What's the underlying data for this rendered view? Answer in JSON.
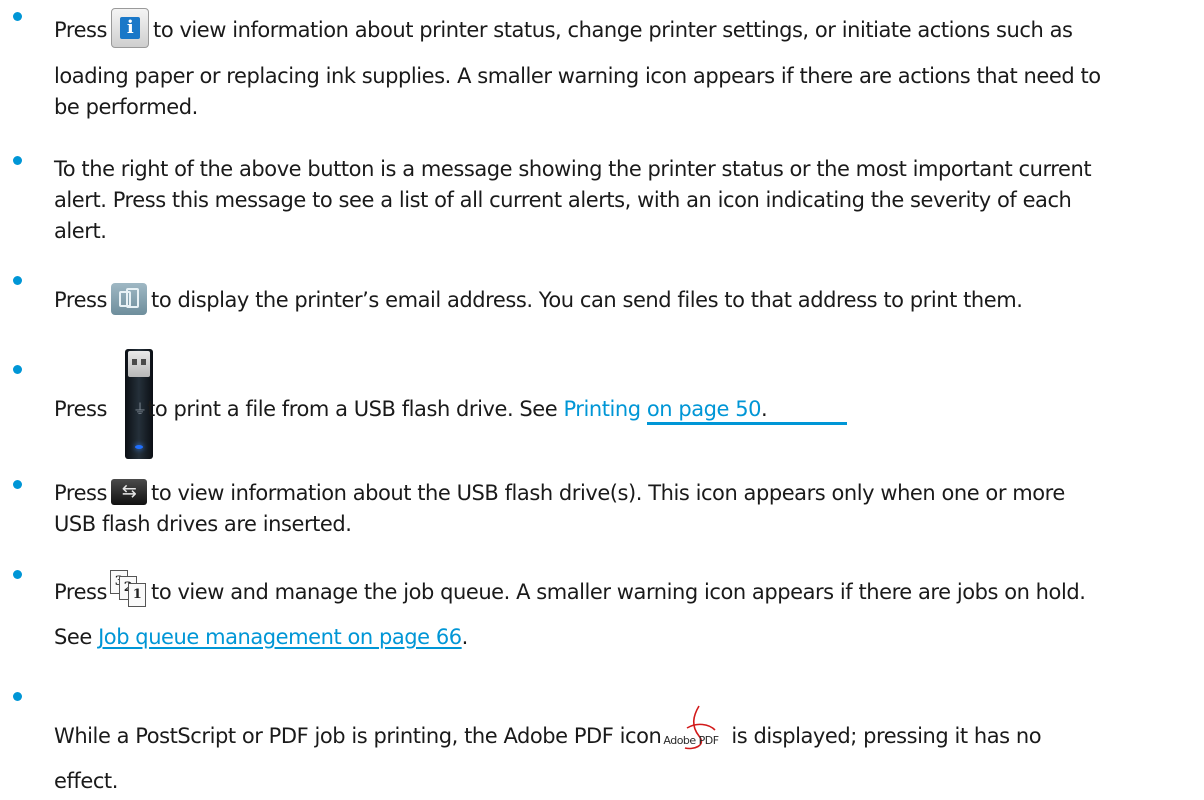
{
  "items": [
    {
      "line1_pre": "Press",
      "line1_post": "to view information about printer status, change printer settings, or initiate actions such as",
      "line2": "loading paper or replacing ink supplies. A smaller warning icon appears if there are actions that need to",
      "line3": "be performed.",
      "icon": "info-icon"
    },
    {
      "line1": "To the right of the above button is a message showing the printer status or the most important current",
      "line2": "alert. Press this message to see a list of all current alerts, with an icon indicating the severity of each",
      "line3": "alert."
    },
    {
      "line1_pre": "Press",
      "line1_post": "to display the printer’s email address. You can send files to that address to print them.",
      "icon": "email-icon"
    },
    {
      "line1_pre": "Press",
      "line1_mid": "to print a file from a USB flash drive. See",
      "link": "Printing on page 50",
      "line1_end": ".",
      "icon": "usb-flash-drive-icon"
    },
    {
      "line1_pre": "Press",
      "line1_post": "to view information about the USB flash drive(s). This icon appears only when one or more",
      "line2": "USB flash drives are inserted.",
      "icon": "usb-icon"
    },
    {
      "line1_pre": "Press",
      "line1_post": "to view and manage the job queue. A smaller warning icon appears if there are jobs on hold.",
      "line2_pre": "See",
      "link": "Job queue management on page 66",
      "line2_end": ".",
      "icon": "job-queue-icon",
      "icon_pages": [
        "3",
        "2",
        "1"
      ]
    },
    {
      "line1_pre": "While a PostScript or PDF job is printing, the Adobe PDF icon",
      "icon_text": "Adobe PDF",
      "line1_post": "is displayed; pressing it has no",
      "line2": "effect.",
      "icon": "adobe-pdf-icon"
    }
  ],
  "colors": {
    "link": "#0096d6",
    "bullet": "#0096d6",
    "text": "#1a1a1a"
  }
}
